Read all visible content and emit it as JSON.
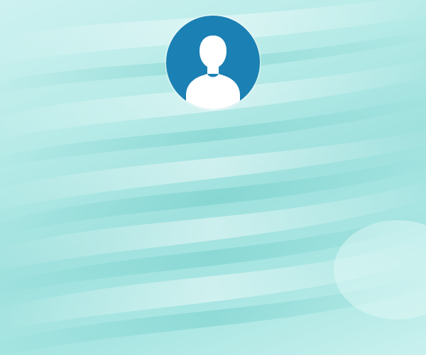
{
  "screen": {
    "type": "login-screen",
    "wallpaper": "teal-silk-texture",
    "colors": {
      "wallpaper_light": "#cdf1f0",
      "wallpaper_mid": "#a6e5e2",
      "wallpaper_shadow": "#7fd3cf",
      "avatar_background": "#1b80b3",
      "avatar_figure": "#ffffff"
    }
  },
  "user": {
    "avatar_icon": "user-silhouette-icon"
  }
}
